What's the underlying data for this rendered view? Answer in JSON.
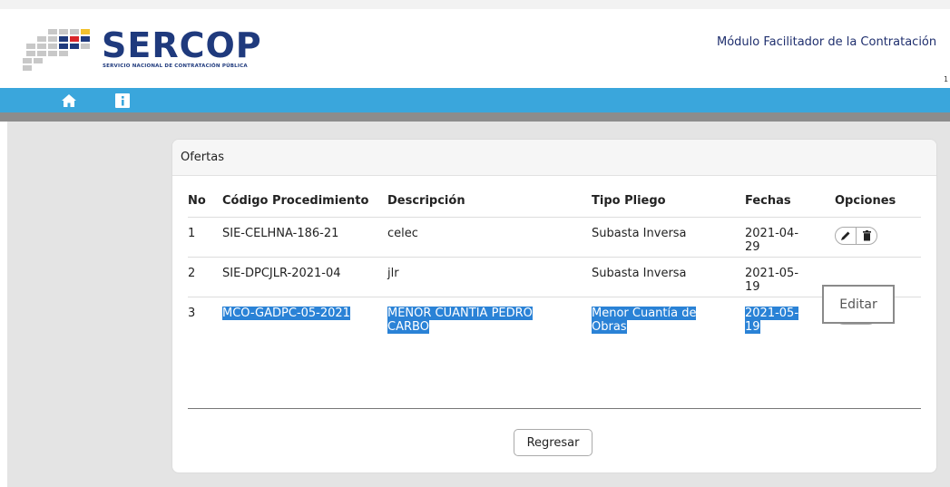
{
  "header": {
    "logo_title": "SERCOP",
    "logo_subtitle": "SERVICIO NACIONAL DE CONTRATACIÓN PÚBLICA",
    "module_title": "Módulo Facilitador de la Contratación",
    "small_text": "1"
  },
  "nav": {
    "home_icon": "home-icon",
    "info_icon": "info-icon"
  },
  "card": {
    "title": "Ofertas",
    "columns": {
      "no": "No",
      "codigo": "Código Procedimiento",
      "descripcion": "Descripción",
      "tipo": "Tipo Pliego",
      "fechas": "Fechas",
      "opciones": "Opciones"
    },
    "rows": [
      {
        "no": "1",
        "codigo": "SIE-CELHNA-186-21",
        "descripcion": "celec",
        "tipo": "Subasta Inversa",
        "fecha": "2021-04-29"
      },
      {
        "no": "2",
        "codigo": "SIE-DPCJLR-2021-04",
        "descripcion": "jlr",
        "tipo": "Subasta Inversa",
        "fecha": "2021-05-19"
      },
      {
        "no": "3",
        "codigo": "MCO-GADPC-05-2021",
        "descripcion": "MENOR CUANTIA PEDRO CARBO",
        "tipo": "Menor Cuantía de Obras",
        "fecha": "2021-05-19"
      }
    ],
    "back_button": "Regresar"
  },
  "tooltip": "Editar",
  "colors": {
    "nav": "#3aa6dc",
    "brand": "#1f3a7d",
    "selection": "#2a82d6"
  }
}
